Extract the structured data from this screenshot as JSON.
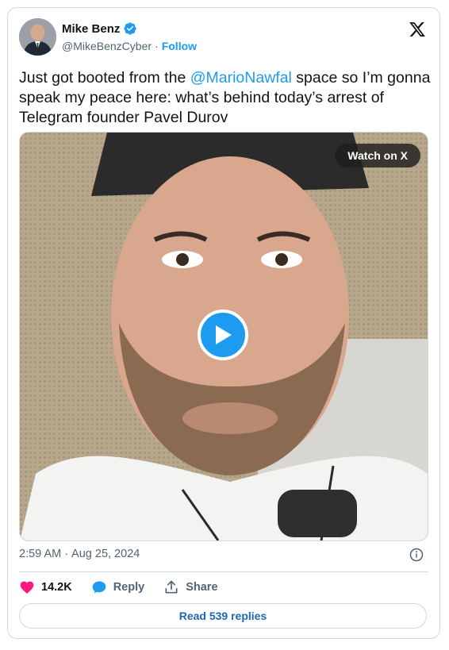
{
  "author": {
    "name": "Mike Benz",
    "handle": "@MikeBenzCyber",
    "separator": "·",
    "follow_label": "Follow"
  },
  "tweet": {
    "text_before": "Just got booted from the ",
    "mention": "@MarioNawfal",
    "text_after": " space so I’m gonna speak my peace here: what’s behind today’s arrest of Telegram founder Pavel Durov"
  },
  "media": {
    "watch_label": "Watch on X"
  },
  "meta": {
    "time": "2:59 AM",
    "separator": "·",
    "date": "Aug 25, 2024"
  },
  "actions": {
    "like_count": "14.2K",
    "reply_label": "Reply",
    "share_label": "Share"
  },
  "read_replies_label": "Read 539 replies",
  "colors": {
    "accent": "#1d9bf0",
    "like": "#f91880",
    "text": "#0f1419",
    "muted": "#536471",
    "border": "#cfd9de"
  },
  "icons": [
    "verified-badge-icon",
    "x-logo-icon",
    "play-icon",
    "info-icon",
    "heart-icon",
    "reply-icon",
    "share-icon"
  ]
}
